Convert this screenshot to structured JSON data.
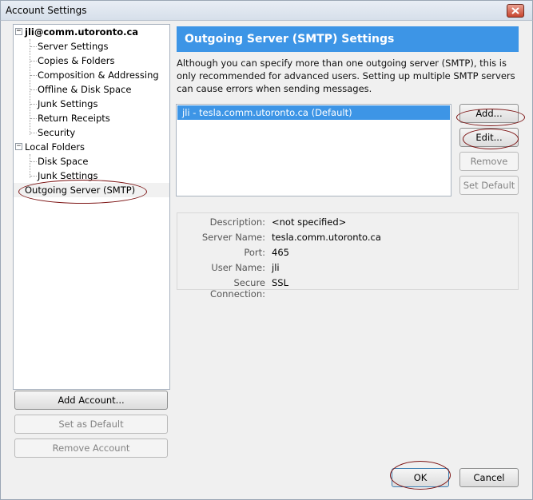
{
  "window": {
    "title": "Account Settings",
    "close_icon": "close-icon"
  },
  "tree": {
    "account": {
      "name": "jli@comm.utoronto.ca",
      "children": [
        "Server Settings",
        "Copies & Folders",
        "Composition & Addressing",
        "Offline & Disk Space",
        "Junk Settings",
        "Return Receipts",
        "Security"
      ]
    },
    "local": {
      "name": "Local Folders",
      "children": [
        "Disk Space",
        "Junk Settings"
      ]
    },
    "outgoing": "Outgoing Server (SMTP)"
  },
  "left_buttons": {
    "add_account": "Add Account...",
    "set_default": "Set as Default",
    "remove_account": "Remove Account"
  },
  "panel": {
    "header": "Outgoing Server (SMTP) Settings",
    "description": "Although you can specify more than one outgoing server (SMTP), this is only recommended for advanced users. Setting up multiple SMTP servers can cause errors when sending messages.",
    "servers": [
      "jli - tesla.comm.utoronto.ca (Default)"
    ],
    "buttons": {
      "add": "Add...",
      "edit": "Edit...",
      "remove": "Remove",
      "set_default": "Set Default"
    },
    "details": {
      "description_label": "Description:",
      "description_value": "<not specified>",
      "server_label": "Server Name:",
      "server_value": "tesla.comm.utoronto.ca",
      "port_label": "Port:",
      "port_value": "465",
      "user_label": "User Name:",
      "user_value": "jli",
      "secure_label": "Secure Connection:",
      "secure_value": "SSL"
    }
  },
  "footer": {
    "ok": "OK",
    "cancel": "Cancel"
  },
  "colors": {
    "accent": "#3d95e6",
    "annotation": "#7b1111"
  }
}
